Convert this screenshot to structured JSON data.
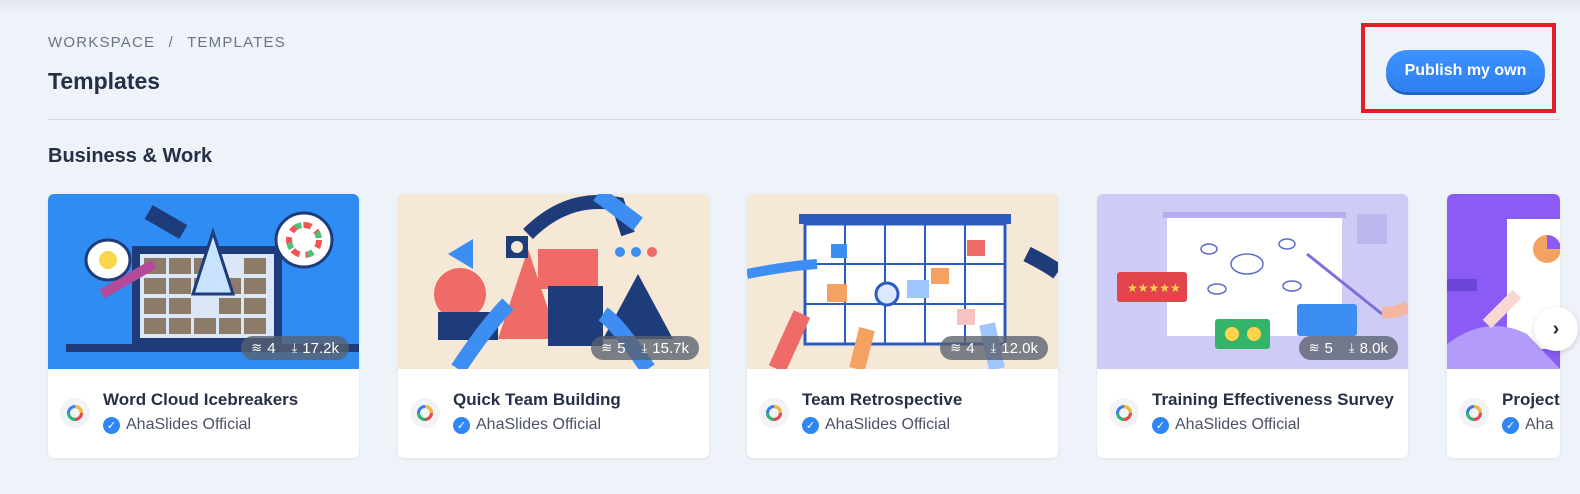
{
  "breadcrumb": {
    "workspace": "WORKSPACE",
    "separator": "/",
    "templates": "TEMPLATES"
  },
  "page": {
    "title": "Templates",
    "publish_label": "Publish my own"
  },
  "section": {
    "title": "Business & Work"
  },
  "colors": {
    "accent": "#2f86f6",
    "highlight": "#e01f26",
    "background": "#eef2f9"
  },
  "cards": [
    {
      "title": "Word Cloud Icebreakers",
      "author": "AhaSlides Official",
      "slides": "4",
      "downloads": "17.2k"
    },
    {
      "title": "Quick Team Building",
      "author": "AhaSlides Official",
      "slides": "5",
      "downloads": "15.7k"
    },
    {
      "title": "Team Retrospective",
      "author": "AhaSlides Official",
      "slides": "4",
      "downloads": "12.0k"
    },
    {
      "title": "Training Effectiveness Survey",
      "author": "AhaSlides Official",
      "slides": "5",
      "downloads": "8.0k"
    },
    {
      "title": "Project",
      "author": "Aha"
    }
  ],
  "icons": {
    "layers": "layers-icon",
    "download": "download-icon",
    "verified": "verified-badge-icon",
    "next": "chevron-right-icon"
  }
}
